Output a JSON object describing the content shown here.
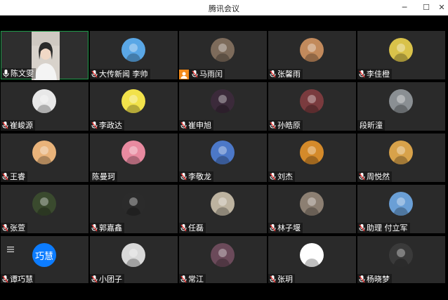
{
  "window": {
    "title": "腾讯会议",
    "minimize": "─",
    "maximize": "☐",
    "close": "✕"
  },
  "participants": [
    {
      "name": "陈文雯",
      "kind": "video",
      "mic": "on",
      "active": true
    },
    {
      "name": "大传新闻   李帅",
      "kind": "avatar",
      "color": "#5aa7e6",
      "mic": "muted"
    },
    {
      "name": "马雨闰",
      "kind": "avatar",
      "color": "#7d6b5b",
      "mic": "muted",
      "host_badge": true
    },
    {
      "name": "张馨雨",
      "kind": "avatar",
      "color": "#c28a5c",
      "mic": "muted"
    },
    {
      "name": "李佳橙",
      "kind": "avatar",
      "color": "#d9c24a",
      "mic": "muted"
    },
    {
      "name": "崔峻源",
      "kind": "avatar",
      "color": "#e8e8e8",
      "mic": "muted"
    },
    {
      "name": "李政达",
      "kind": "avatar",
      "color": "#f2e24b",
      "mic": "muted"
    },
    {
      "name": "崔申旭",
      "kind": "avatar",
      "color": "#3b2a3a",
      "mic": "muted"
    },
    {
      "name": "孙皓原",
      "kind": "avatar",
      "color": "#7a3b3e",
      "mic": "muted"
    },
    {
      "name": "段昕潼",
      "kind": "avatar",
      "color": "#8a8f93",
      "mic": "none"
    },
    {
      "name": "王睿",
      "kind": "avatar",
      "color": "#e9b37a",
      "mic": "muted"
    },
    {
      "name": "陈曼珂",
      "kind": "avatar",
      "color": "#e88aa0",
      "mic": "none"
    },
    {
      "name": "李敬龙",
      "kind": "avatar",
      "color": "#4c78c8",
      "mic": "muted"
    },
    {
      "name": "刘杰",
      "kind": "avatar",
      "color": "#d48a2a",
      "mic": "muted"
    },
    {
      "name": "周悦然",
      "kind": "avatar",
      "color": "#d8a24a",
      "mic": "muted"
    },
    {
      "name": "张萱",
      "kind": "avatar",
      "color": "#3a4a2e",
      "mic": "muted"
    },
    {
      "name": "郭嘉鑫",
      "kind": "avatar",
      "color": "#2b2b2b",
      "mic": "muted"
    },
    {
      "name": "任磊",
      "kind": "avatar",
      "color": "#bdb3a0",
      "mic": "muted"
    },
    {
      "name": "林子堰",
      "kind": "avatar",
      "color": "#8c7f72",
      "mic": "muted"
    },
    {
      "name": "助理 付立军",
      "kind": "avatar",
      "color": "#6a9fd6",
      "mic": "muted"
    },
    {
      "name": "谭巧慧",
      "kind": "text",
      "text": "巧慧",
      "mic": "muted",
      "menu_icon": true
    },
    {
      "name": "小团子",
      "kind": "avatar",
      "color": "#d9d9d9",
      "mic": "muted"
    },
    {
      "name": "常江",
      "kind": "avatar",
      "color": "#6b4a5a",
      "mic": "muted"
    },
    {
      "name": "张玥",
      "kind": "avatar",
      "color": "#ffffff",
      "mic": "muted"
    },
    {
      "name": "杨晓梦",
      "kind": "avatar",
      "color": "#3a3a3a",
      "mic": "muted"
    }
  ]
}
